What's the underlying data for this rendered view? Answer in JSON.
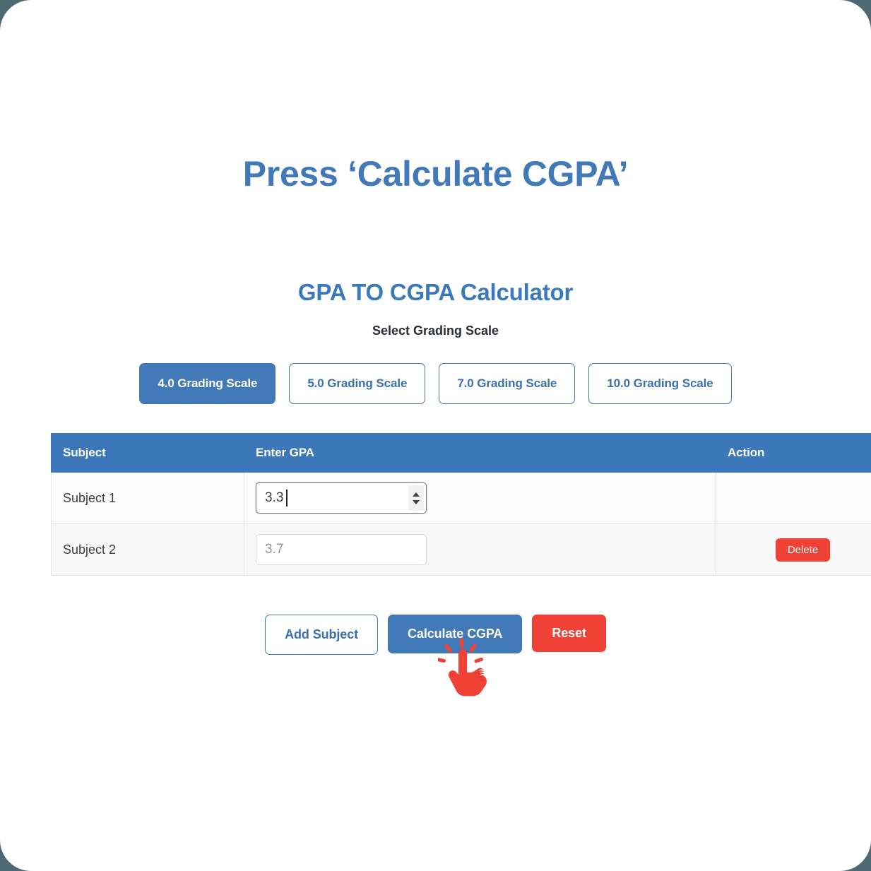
{
  "page": {
    "title": "Press ‘Calculate CGPA’",
    "section_title": "GPA TO CGPA Calculator",
    "scale_label": "Select Grading Scale"
  },
  "colors": {
    "brand_blue": "#4279b8",
    "table_header_blue": "#3b77b9",
    "danger_red": "#ef4136",
    "page_backdrop": "#4d6a72",
    "card_background": "#ffffff"
  },
  "grading_scales": [
    {
      "label": "4.0 Grading Scale",
      "active": true
    },
    {
      "label": "5.0 Grading Scale",
      "active": false
    },
    {
      "label": "7.0 Grading Scale",
      "active": false
    },
    {
      "label": "10.0 Grading Scale",
      "active": false
    }
  ],
  "table": {
    "headers": [
      "Subject",
      "Enter GPA",
      "Action"
    ],
    "rows": [
      {
        "subject": "Subject 1",
        "gpa_value": "3.3",
        "gpa_placeholder": "",
        "focused": true,
        "has_delete": false,
        "delete_label": ""
      },
      {
        "subject": "Subject 2",
        "gpa_value": "",
        "gpa_placeholder": "3.7",
        "focused": false,
        "has_delete": true,
        "delete_label": "Delete"
      }
    ]
  },
  "actions": {
    "add_subject": "Add Subject",
    "calculate": "Calculate CGPA",
    "reset": "Reset"
  },
  "cursor": {
    "icon": "click-hand-cursor-icon",
    "color": "#ef4136"
  }
}
